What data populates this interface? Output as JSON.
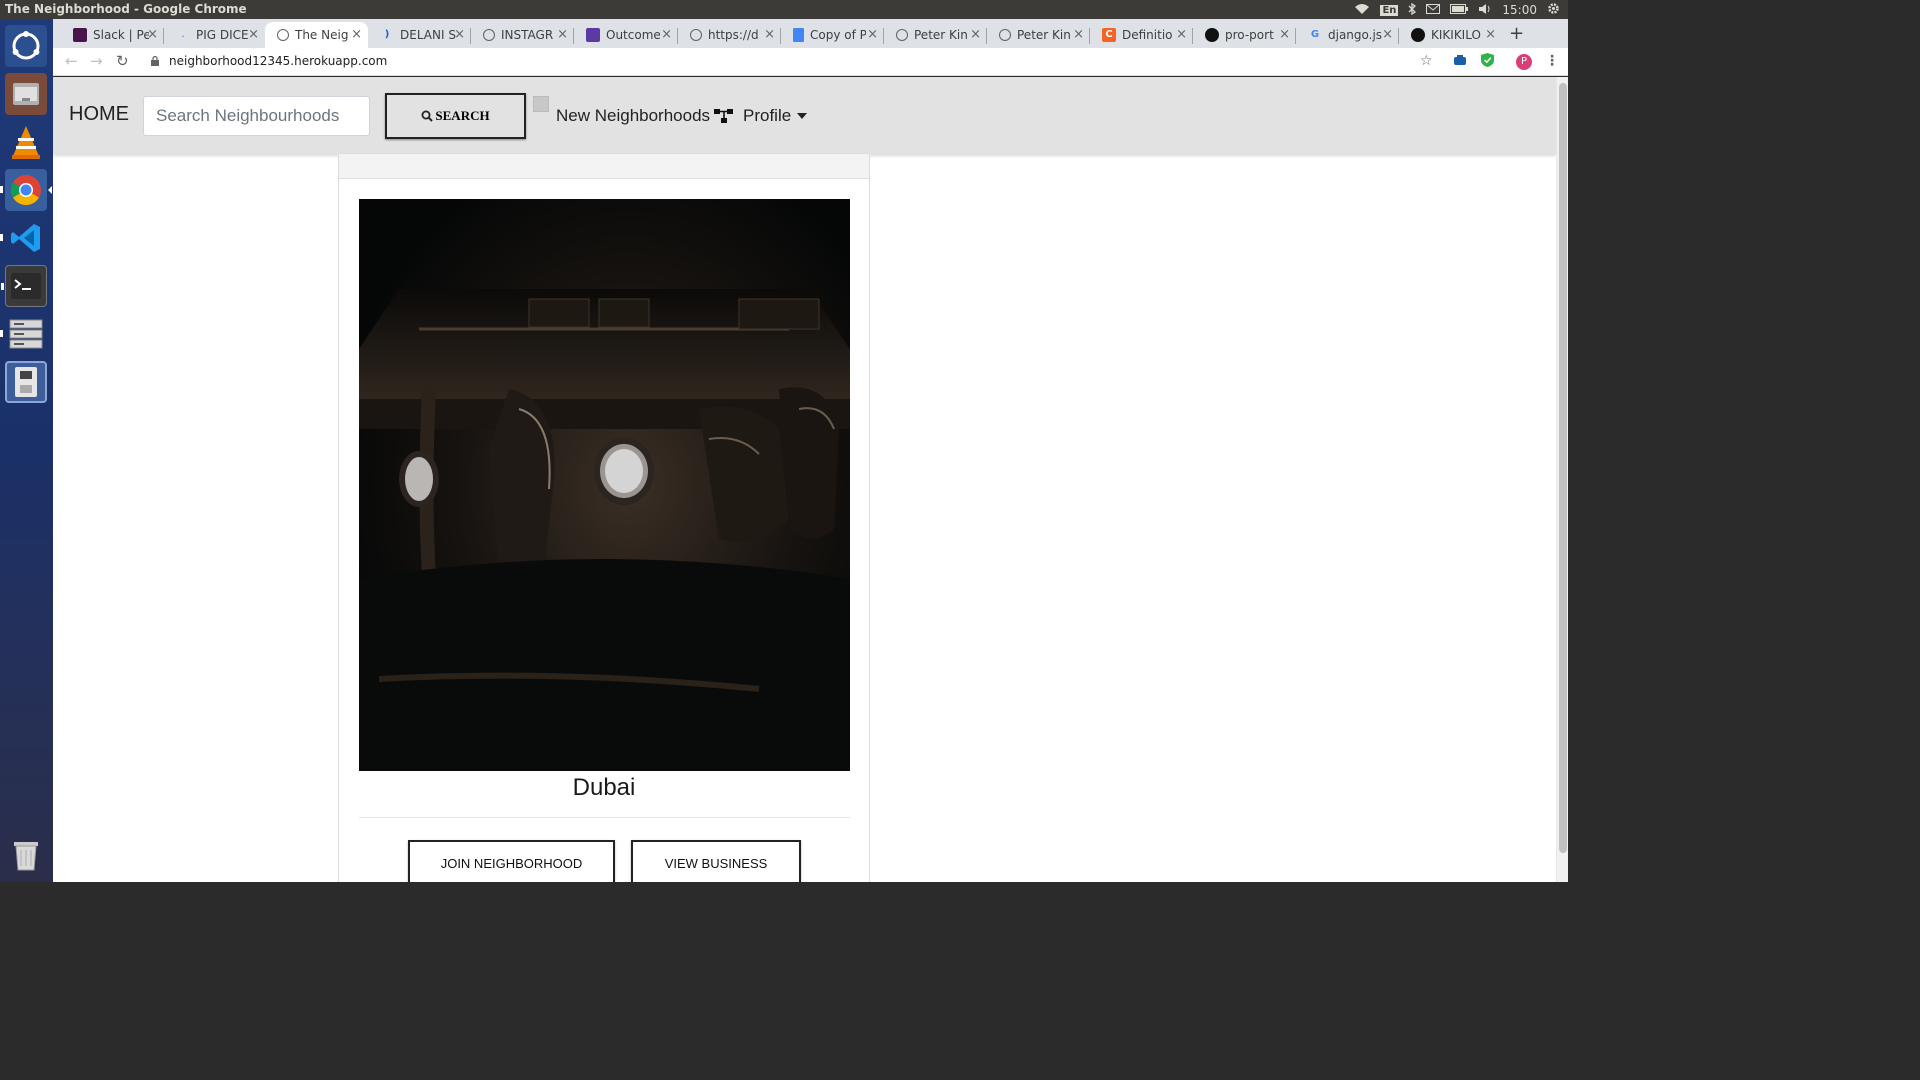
{
  "os": {
    "window_title": "The Neighborhood - Google Chrome",
    "keyboard_layout": "En",
    "clock": "15:00"
  },
  "launcher": {
    "items": [
      {
        "name": "ubuntu-dash-icon"
      },
      {
        "name": "files-icon"
      },
      {
        "name": "vlc-icon"
      },
      {
        "name": "chrome-icon"
      },
      {
        "name": "vscode-icon"
      },
      {
        "name": "terminal-icon"
      },
      {
        "name": "file-manager-icon"
      },
      {
        "name": "drive-icon"
      },
      {
        "name": "trash-icon"
      }
    ]
  },
  "browser": {
    "tabs": [
      {
        "label": "Slack | Pe",
        "favicon": "slack-icon",
        "color": "#4a154b"
      },
      {
        "label": "PIG DICE",
        "favicon": "dot-icon",
        "color": "#1a73e8"
      },
      {
        "label": "The Neig",
        "favicon": "globe-icon",
        "color": "#5f6368",
        "active": true
      },
      {
        "label": "DELANI S",
        "favicon": "moon-icon",
        "color": "#1a5fd6"
      },
      {
        "label": "INSTAGR",
        "favicon": "globe-icon",
        "color": "#5f6368"
      },
      {
        "label": "Outcome",
        "favicon": "list-icon",
        "color": "#5b3aa6"
      },
      {
        "label": "https://d",
        "favicon": "globe-icon",
        "color": "#5f6368"
      },
      {
        "label": "Copy of P",
        "favicon": "doc-icon",
        "color": "#4285f4"
      },
      {
        "label": "Peter Kin",
        "favicon": "globe-icon",
        "color": "#5f6368"
      },
      {
        "label": "Peter Kin",
        "favicon": "globe-icon",
        "color": "#5f6368"
      },
      {
        "label": "Definitio",
        "favicon": "c-icon",
        "color": "#f26522"
      },
      {
        "label": "pro-port",
        "favicon": "github-icon",
        "color": "#111"
      },
      {
        "label": "django.js",
        "favicon": "google-icon",
        "color": "#4285f4"
      },
      {
        "label": "KIKIKILO",
        "favicon": "github-icon",
        "color": "#111"
      }
    ],
    "new_tab_label": "+",
    "url": "neighborhood12345.herokuapp.com",
    "avatar_letter": "P"
  },
  "navbar": {
    "home": "HOME",
    "search_placeholder": "Search Neighbourhoods",
    "search_button": "SEARCH",
    "new_neighborhoods": "New Neighborhoods",
    "profile": "Profile"
  },
  "card": {
    "title": "Dubai",
    "image_description": "dark airplane cabin interior",
    "join_button": "JOIN NEIGHBORHOOD",
    "view_button": "VIEW BUSINESS"
  },
  "colors": {
    "navbar_bg": "#e2e2e2",
    "panel_bg": "#3c3b37",
    "launcher_bg": "#1f3a7a"
  }
}
